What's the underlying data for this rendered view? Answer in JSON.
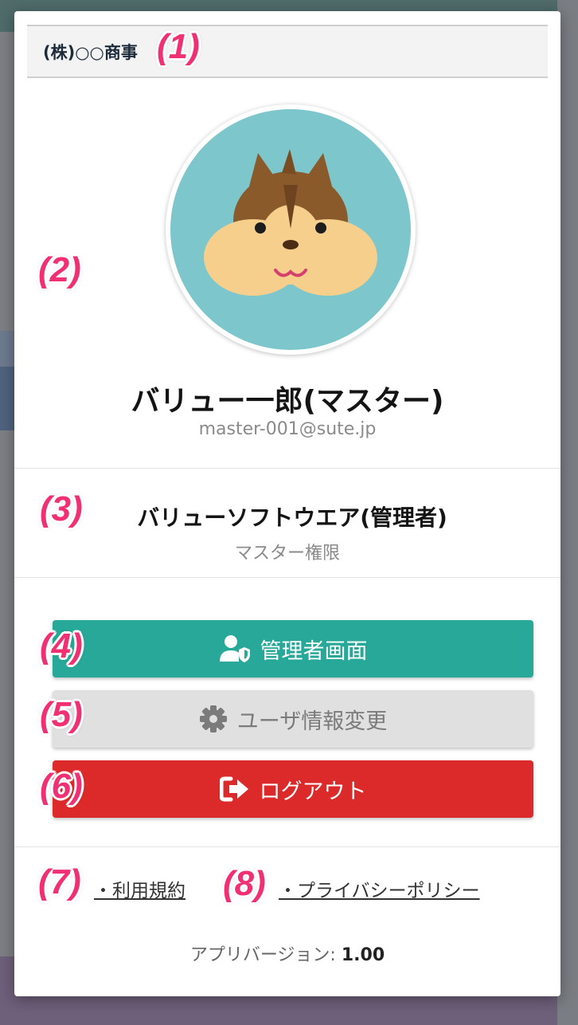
{
  "company": {
    "name": "(株)○○商事"
  },
  "user": {
    "name": "バリュー一郎(マスター)",
    "email": "master-001@sute.jp"
  },
  "role": {
    "name": "バリューソフトウエア(管理者)",
    "level": "マスター権限"
  },
  "buttons": {
    "admin": {
      "label": "管理者画面",
      "icon": "user-shield-icon"
    },
    "user_info": {
      "label": "ユーザ情報変更",
      "icon": "gear-icon"
    },
    "logout": {
      "label": "ログアウト",
      "icon": "sign-out-icon"
    }
  },
  "links": {
    "terms": "・利用規約",
    "privacy": "・プライバシーポリシー"
  },
  "version": {
    "label": "アプリバージョン: ",
    "value": "1.00"
  },
  "markers": [
    "(1)",
    "(2)",
    "(3)",
    "(4)",
    "(5)",
    "(6)",
    "(7)",
    "(8)"
  ],
  "colors": {
    "admin_button": "#27a898",
    "user_button": "#e0e0e0",
    "logout_button": "#dc2a2a",
    "marker": "#f03072"
  }
}
